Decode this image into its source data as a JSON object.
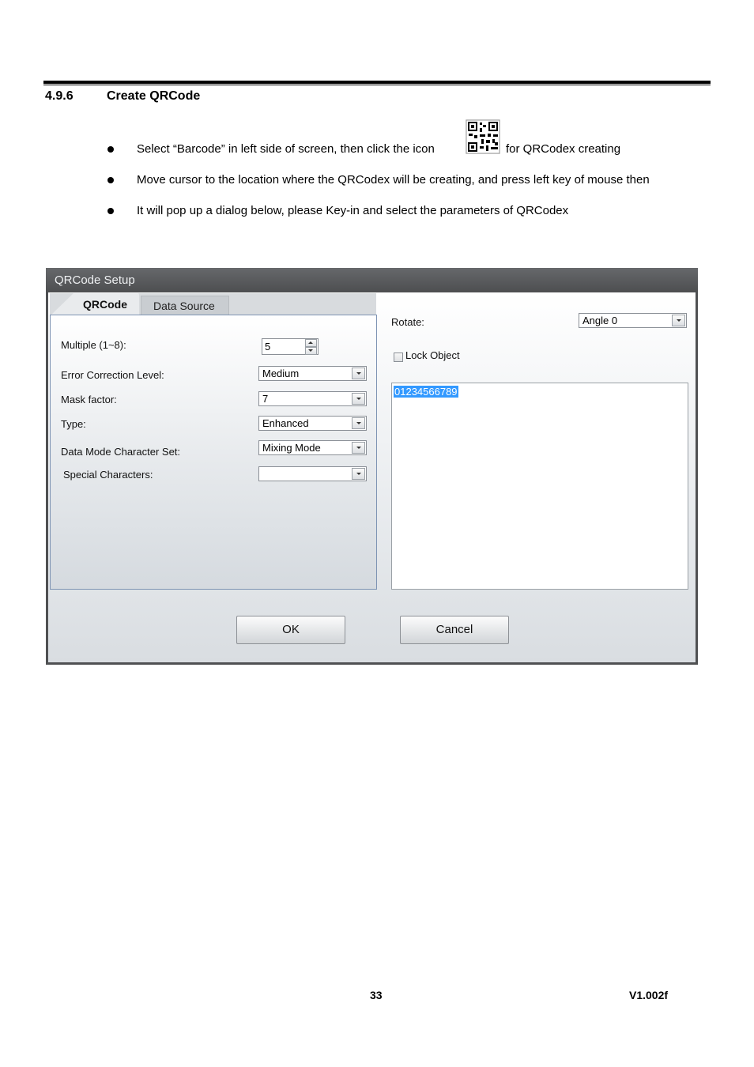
{
  "section": {
    "number": "4.9.6",
    "title": "Create QRCode"
  },
  "bullets": [
    {
      "text_before_icon": "Select “Barcode” in left side of screen, then click the icon",
      "text_after_icon": "for QRCodex creating"
    },
    {
      "text": "Move cursor to the location where the QRCodex will be creating, and press left key of mouse then"
    },
    {
      "text": "It will pop up a dialog below, please Key-in and select the parameters of QRCodex"
    }
  ],
  "dialog": {
    "title": "QRCode Setup",
    "tabs": [
      {
        "label": "QRCode",
        "active": true
      },
      {
        "label": "Data Source",
        "active": false
      }
    ],
    "fields": {
      "multiple": {
        "label": "Multiple (1~8):",
        "value": "5"
      },
      "error_correction": {
        "label": "Error Correction Level:",
        "value": "Medium"
      },
      "mask_factor": {
        "label": "Mask factor:",
        "value": "7"
      },
      "type": {
        "label": "Type:",
        "value": "Enhanced"
      },
      "data_mode": {
        "label": "Data Mode Character Set:",
        "value": "Mixing Mode"
      },
      "special_characters": {
        "label": "Special Characters:",
        "value": ""
      },
      "rotate": {
        "label": "Rotate:",
        "value": "Angle 0"
      },
      "lock_object": {
        "label": "Lock Object",
        "checked": false
      },
      "content": {
        "value": "01234566789"
      }
    },
    "buttons": {
      "ok": "OK",
      "cancel": "Cancel"
    }
  },
  "footer": {
    "page_number": "33",
    "version": "V1.002f"
  }
}
